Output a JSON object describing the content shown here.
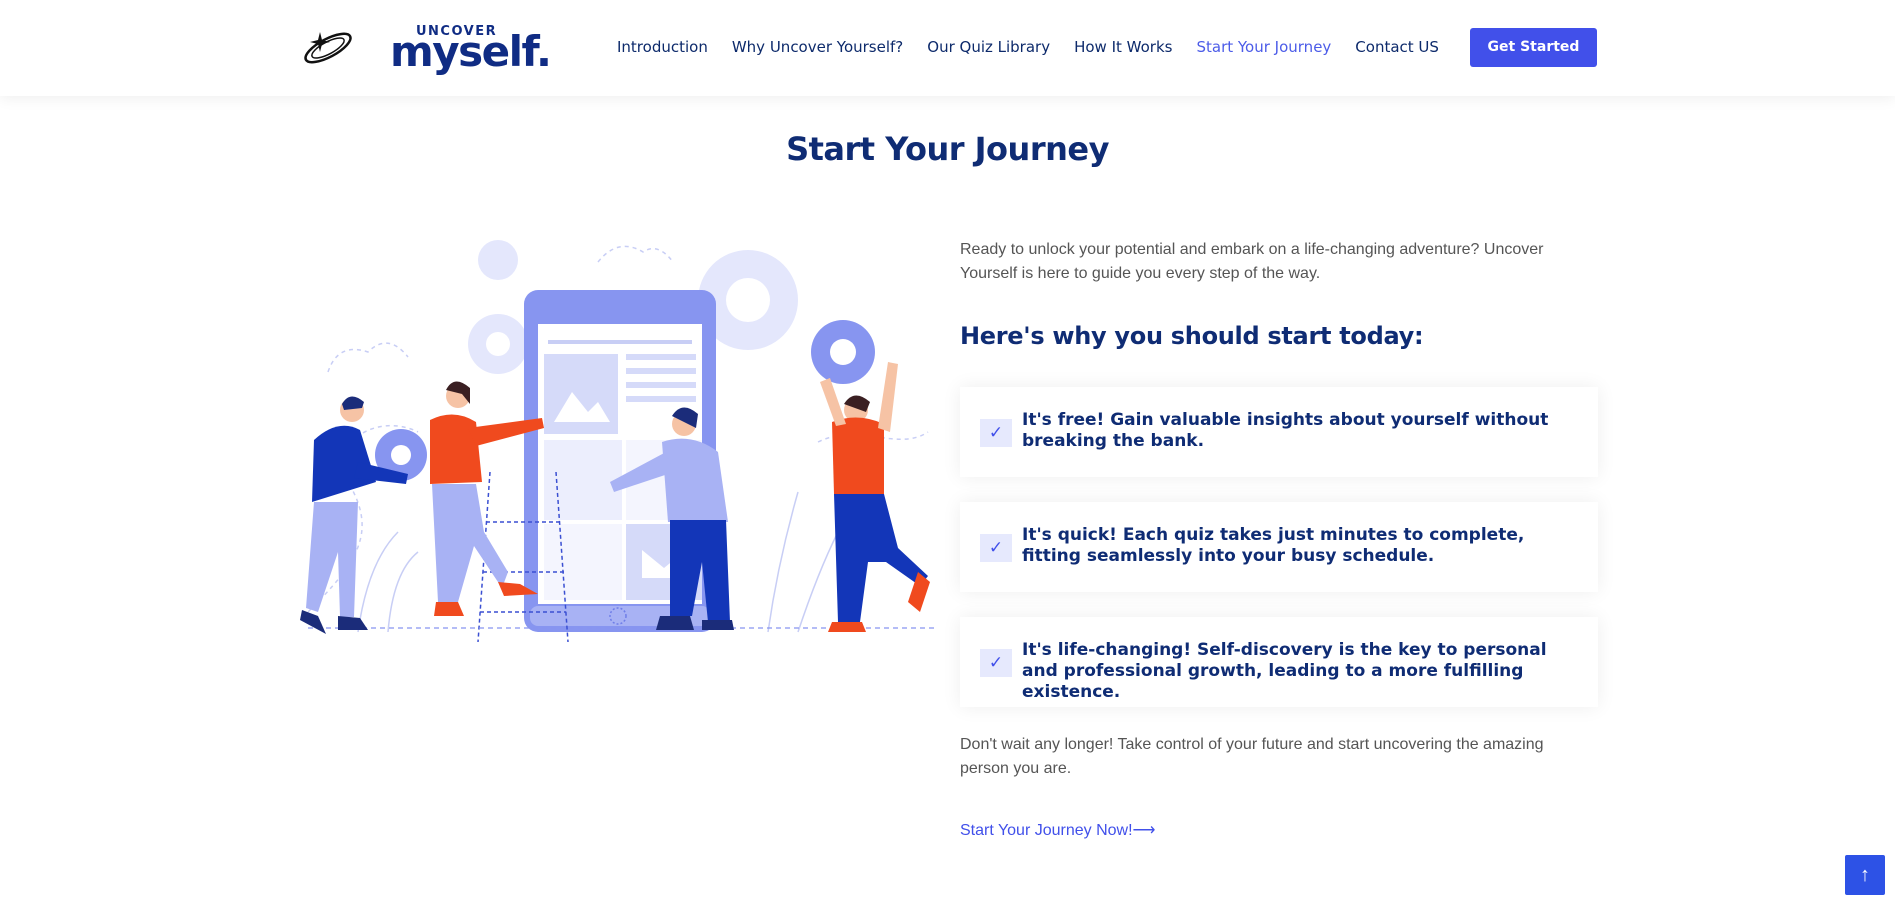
{
  "header": {
    "logo_small": "UNCOVER",
    "logo_big": "myself.",
    "nav": [
      {
        "label": "Introduction"
      },
      {
        "label": "Why Uncover Yourself?"
      },
      {
        "label": "Our Quiz Library"
      },
      {
        "label": "How It Works"
      },
      {
        "label": "Start Your Journey",
        "active": true
      },
      {
        "label": "Contact US"
      }
    ],
    "cta_label": "Get Started"
  },
  "section": {
    "title": "Start Your Journey",
    "intro": "Ready to unlock your potential and embark on a life-changing adventure? Uncover Yourself is here to guide you every step of the way.",
    "why_heading": "Here's why you should start today:",
    "reasons": [
      "It's free! Gain valuable insights about yourself without breaking the bank.",
      "It's quick! Each quiz takes just minutes to complete, fitting seamlessly into your busy schedule.",
      "It's life-changing! Self-discovery is the key to personal and professional growth, leading to a more fulfilling existence."
    ],
    "outro": "Don't wait any longer! Take control of your future and start uncovering the amazing person you are.",
    "link_label": "Start Your Journey Now!",
    "link_arrow": "⟶"
  },
  "icons": {
    "check": "check-icon",
    "scroll_top": "arrow-up-icon",
    "logo": "orbit-logo-icon"
  },
  "colors": {
    "brand_blue": "#4150ea",
    "navy": "#0f2c74",
    "light_blue": "#e6e9fd",
    "illustration_orange": "#f04a1e"
  },
  "scroll_top_glyph": "↑",
  "check_glyph": "✓"
}
